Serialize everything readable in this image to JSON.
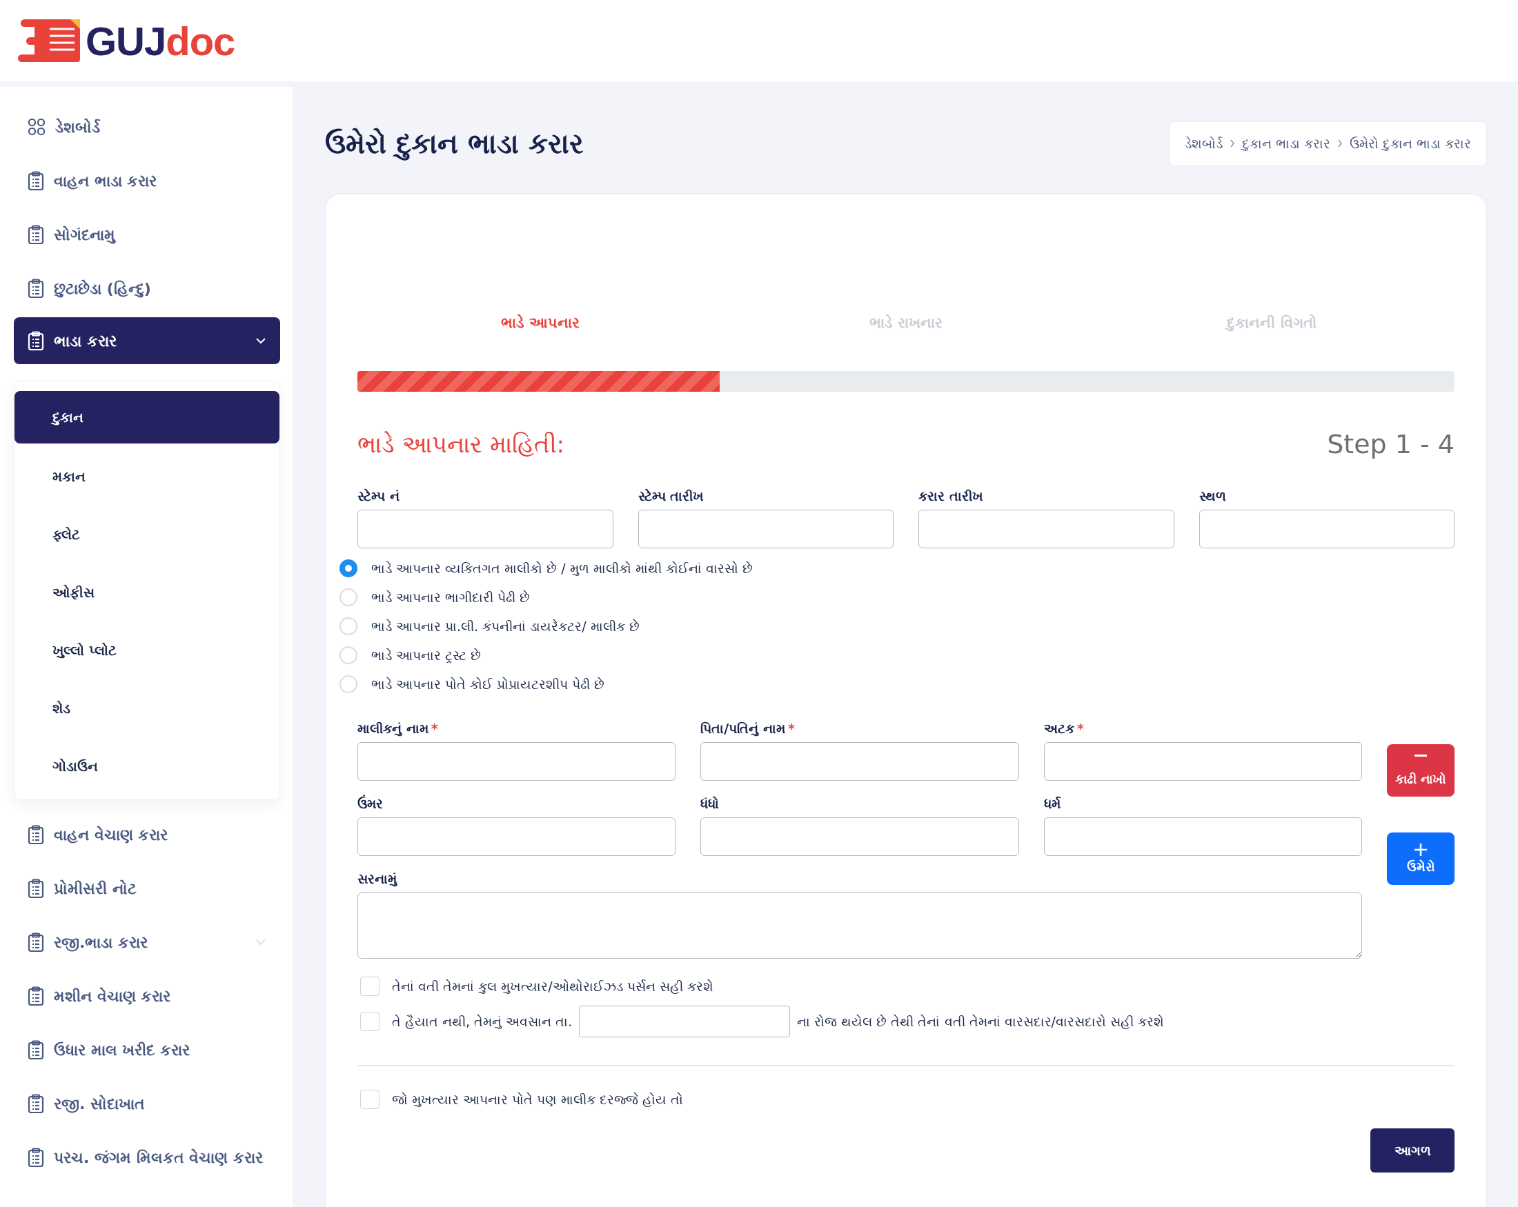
{
  "logo": {
    "main": "GUJ",
    "accent": "doc"
  },
  "sidebar": {
    "items": [
      {
        "label": "ડેશબોર્ડ",
        "kind": "grid",
        "selected": false
      },
      {
        "label": "વાહન ભાડા કરાર",
        "kind": "clipboard",
        "selected": false
      },
      {
        "label": "સોગંદનામુ",
        "kind": "clipboard",
        "selected": false
      },
      {
        "label": "છુટાછેડા (હિન્દુ)",
        "kind": "clipboard",
        "selected": false
      },
      {
        "label": "ભાડા કરાર",
        "kind": "clipboard",
        "selected": true,
        "expanded": true,
        "children": [
          {
            "label": "દુકાન",
            "selected": true
          },
          {
            "label": "મકાન",
            "selected": false
          },
          {
            "label": "ફ્લેટ",
            "selected": false
          },
          {
            "label": "ઓફીસ",
            "selected": false
          },
          {
            "label": "ખુલ્લો પ્લોટ",
            "selected": false
          },
          {
            "label": "શેડ",
            "selected": false
          },
          {
            "label": "ગોડાઉન",
            "selected": false
          }
        ]
      },
      {
        "label": "વાહન વેચાણ કરાર",
        "kind": "clipboard",
        "selected": false
      },
      {
        "label": "પ્રોમીસરી નોટ",
        "kind": "clipboard",
        "selected": false
      },
      {
        "label": "રજી.ભાડા કરાર",
        "kind": "clipboard",
        "selected": false,
        "expanded": false
      },
      {
        "label": "મશીન વેચાણ કરાર",
        "kind": "clipboard",
        "selected": false
      },
      {
        "label": "ઉધાર માલ ખરીદ કરાર",
        "kind": "clipboard",
        "selected": false
      },
      {
        "label": "રજી. સોદાખાત",
        "kind": "clipboard",
        "selected": false
      },
      {
        "label": "પરચ. જંગમ મિલકત વેચાણ કરાર",
        "kind": "clipboard",
        "selected": false
      }
    ]
  },
  "page_title": "ઉમેરો દુકાન ભાડા કરાર",
  "breadcrumb": [
    "ડેશબોર્ડ",
    "દુકાન ભાડા કરાર",
    "ઉમેરો દુકાન ભાડા કરાર"
  ],
  "steps": [
    {
      "label": "ભાડે આપનાર",
      "selected": true
    },
    {
      "label": "ભાડે રાખનાર",
      "selected": false
    },
    {
      "label": "દુકાનની વિગતો",
      "selected": false
    }
  ],
  "progress": {
    "level": 0.33
  },
  "section_title": "ભાડે આપનાર માહિતી:",
  "step_counter": "Step 1 - 4",
  "top_fields": [
    {
      "label": "સ્ટેમ્પ નં"
    },
    {
      "label": "સ્ટેમ્પ તારીખ"
    },
    {
      "label": "કરાર તારીખ"
    },
    {
      "label": "સ્થળ"
    }
  ],
  "owner_type": [
    {
      "label": "ભાડે આપનાર વ્યકિતગત માલીકો છે / મુળ માલીકો માંથી કોઈનાં વારસો છે",
      "selected": true
    },
    {
      "label": "ભાડે આપનાર ભાગીદારી પેઢી છે",
      "selected": false
    },
    {
      "label": "ભાડે આપનાર પ્રા.લી. કંપનીનાં ડાયરેકટર/ માલીક છે",
      "selected": false
    },
    {
      "label": "ભાડે આપનાર ટ્રસ્ટ છે",
      "selected": false
    },
    {
      "label": "ભાડે આપનાર પોતે કોઈ પ્રોપ્રાયટરશીપ પેઢી છે",
      "selected": false
    }
  ],
  "owner_fields": [
    [
      {
        "label": "માલીકનું નામ",
        "required_mark": "*"
      },
      {
        "label": "પિતા/પતિનું નામ",
        "required_mark": "*"
      },
      {
        "label": "અટક",
        "required_mark": "*"
      }
    ],
    [
      {
        "label": "ઉંમર"
      },
      {
        "label": "ધંધો"
      },
      {
        "label": "ધર્મ"
      }
    ]
  ],
  "remove_button": "કાઢી નાખો",
  "add_button": "ઉમેરો",
  "address_label": "સરનામું",
  "checks": [
    {
      "kind": "plain",
      "text": "તેનાં વતી તેમનાં કુલ મુખત્યાર/ઓથોરાઈઝડ પર્સન સહી કરશે",
      "checked": false
    },
    {
      "kind": "date",
      "text": "તે હૈયાત નથી, તેમનું અવસાન તા.",
      "text_after": "ના રોજ થયેલ છે તેથી તેનાં વતી તેમનાં વારસદાર/વારસદારો સહી કરશે",
      "checked": false
    }
  ],
  "owner_check": {
    "text": "જો મુખત્યાર આપનાર પોતે પણ માલીક દરજ્જે હોય તો",
    "checked": false
  },
  "next_button": "આગળ"
}
